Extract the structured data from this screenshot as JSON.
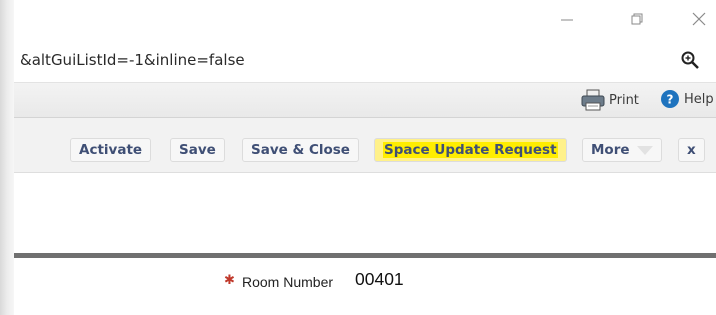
{
  "browser": {
    "url_fragment": "&altGuiListId=-1&inline=false"
  },
  "menubar": {
    "print_label": "Print",
    "help_label": "Help"
  },
  "toolbar": {
    "activate_label": "Activate",
    "save_label": "Save",
    "save_close_label": "Save & Close",
    "space_update_label": "Space Update Request",
    "more_label": "More",
    "close_label": "x"
  },
  "form": {
    "room_number_label": "Room Number",
    "room_number_value": "00401"
  },
  "colors": {
    "button_text": "#3f4f75",
    "highlight": "#ffed00",
    "required_marker": "#c0392b",
    "help_icon": "#1e73be"
  },
  "icons": {
    "minimize": "minimize-icon",
    "restore": "restore-icon",
    "close": "close-window-icon",
    "zoom": "zoom-icon",
    "print": "printer-icon",
    "help": "help-icon",
    "more_dropdown": "chevron-down-icon",
    "required": "asterisk-icon"
  }
}
